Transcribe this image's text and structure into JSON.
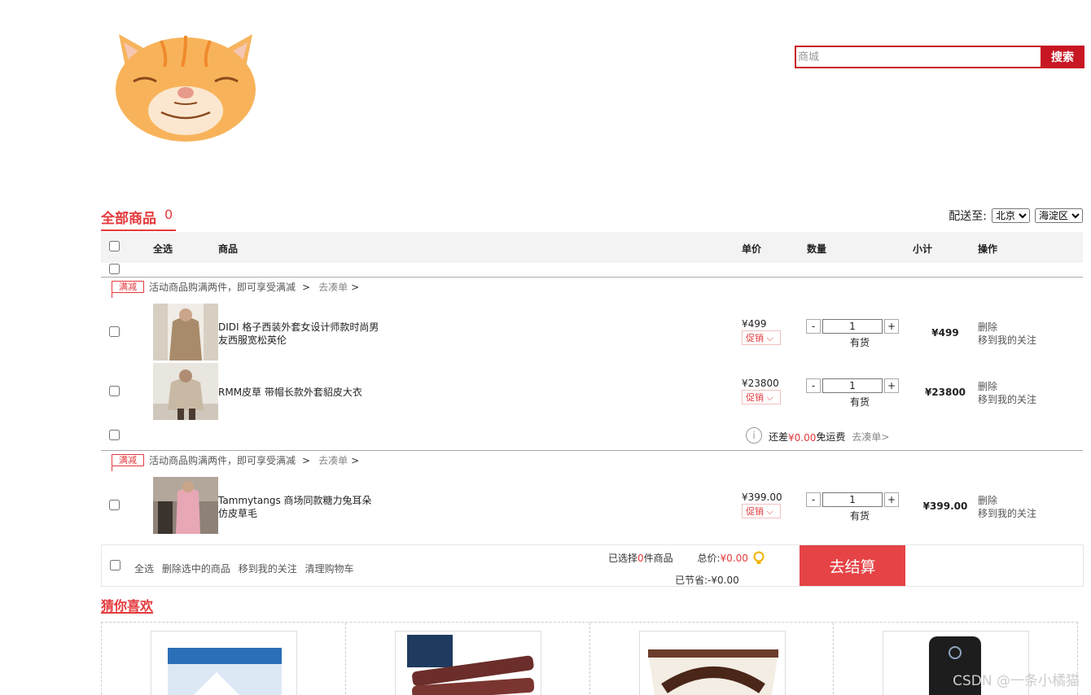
{
  "search": {
    "placeholder": "商城",
    "button": "搜索"
  },
  "cart": {
    "title": "全部商品",
    "count": "0"
  },
  "deliver": {
    "label": "配送至:",
    "city": "北京",
    "district": "海淀区"
  },
  "table_header": {
    "select_all": "全选",
    "product": "商品",
    "unit_price": "单价",
    "quantity": "数量",
    "subtotal": "小计",
    "operation": "操作"
  },
  "promo": {
    "tag": "满减",
    "text": "活动商品购满两件，即可享受满减",
    "arrow1": ">",
    "go": "去凑单",
    "arrow2": ">"
  },
  "items": [
    {
      "name": "DIDI 格子西装外套女设计师款时尚男友西服宽松英伦",
      "price": "¥499",
      "promo_label": "促销 ⌵",
      "qty": "1",
      "minus": "-",
      "plus": "+",
      "stock": "有货",
      "subtotal": "¥499",
      "delete": "删除",
      "follow": "移到我的关注"
    },
    {
      "name": "RMM皮草 带帽长款外套貂皮大衣",
      "price": "¥23800",
      "promo_label": "促销 ⌵",
      "qty": "1",
      "minus": "-",
      "plus": "+",
      "stock": "有货",
      "subtotal": "¥23800",
      "delete": "删除",
      "follow": "移到我的关注"
    },
    {
      "name": "Tammytangs 商场同款糖力兔耳朵仿皮草毛",
      "price": "¥399.00",
      "promo_label": "促销 ⌵",
      "qty": "1",
      "minus": "-",
      "plus": "+",
      "stock": "有货",
      "subtotal": "¥399.00",
      "delete": "删除",
      "follow": "移到我的关注"
    }
  ],
  "freight": {
    "prefix": "还差",
    "amount": "¥0.00",
    "suffix": "免运费",
    "go": "去凑单>"
  },
  "bottom": {
    "select_all": "全选",
    "delete_selected": "删除选中的商品",
    "move_follow": "移到我的关注",
    "clear": "清理购物车",
    "selected_prefix": "已选择",
    "selected_count": "0",
    "selected_suffix": "件商品",
    "total_label": "总价:",
    "total": "¥0.00",
    "saved_label": "已节省:",
    "saved": "-¥0.00",
    "checkout": "去结算"
  },
  "guess": {
    "title": "猜你喜欢"
  },
  "watermark": "CSDN @一条小橘猫",
  "colors": {
    "accent": "#e4393c",
    "search": "#c81623",
    "checkout": "#e54346"
  }
}
